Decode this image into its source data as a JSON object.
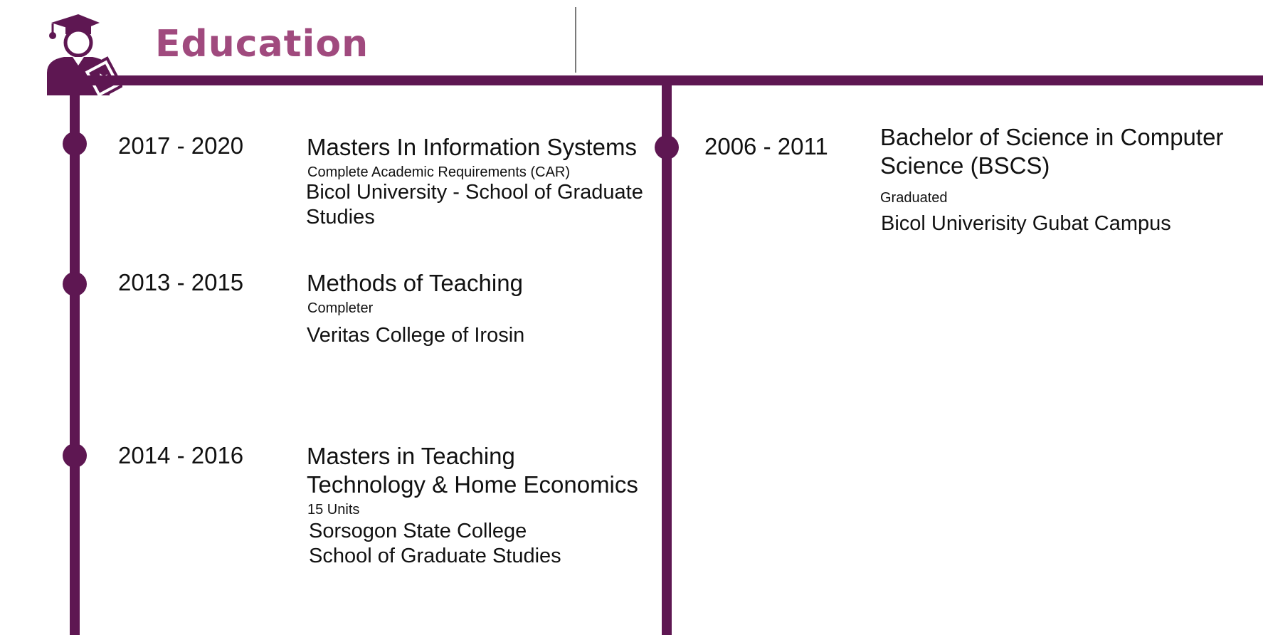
{
  "header": {
    "title": "Education",
    "icon": "graduate-icon",
    "title_color": "#a04a7e",
    "accent_color": "#5e1752"
  },
  "entries_left": [
    {
      "years": "2017 - 2020",
      "degree": "Masters In Information Systems",
      "status": "Complete Academic Requirements (CAR)",
      "school_lines": [
        "Bicol University - School of Graduate",
        "Studies"
      ]
    },
    {
      "years": "2013 - 2015",
      "degree": "Methods of Teaching",
      "status": "Completer",
      "school_lines": [
        "Veritas College of Irosin"
      ]
    },
    {
      "years": "2014 - 2016",
      "degree_lines": [
        "Masters in Teaching",
        "Technology & Home Economics"
      ],
      "status": "15 Units",
      "school_lines": [
        "Sorsogon State College",
        "School of Graduate Studies"
      ]
    }
  ],
  "entries_right": [
    {
      "years": "2006 - 2011",
      "degree_lines": [
        "Bachelor of Science in Computer",
        "Science (BSCS)"
      ],
      "status": "Graduated",
      "school_lines": [
        "Bicol Univerisity Gubat Campus"
      ]
    }
  ]
}
